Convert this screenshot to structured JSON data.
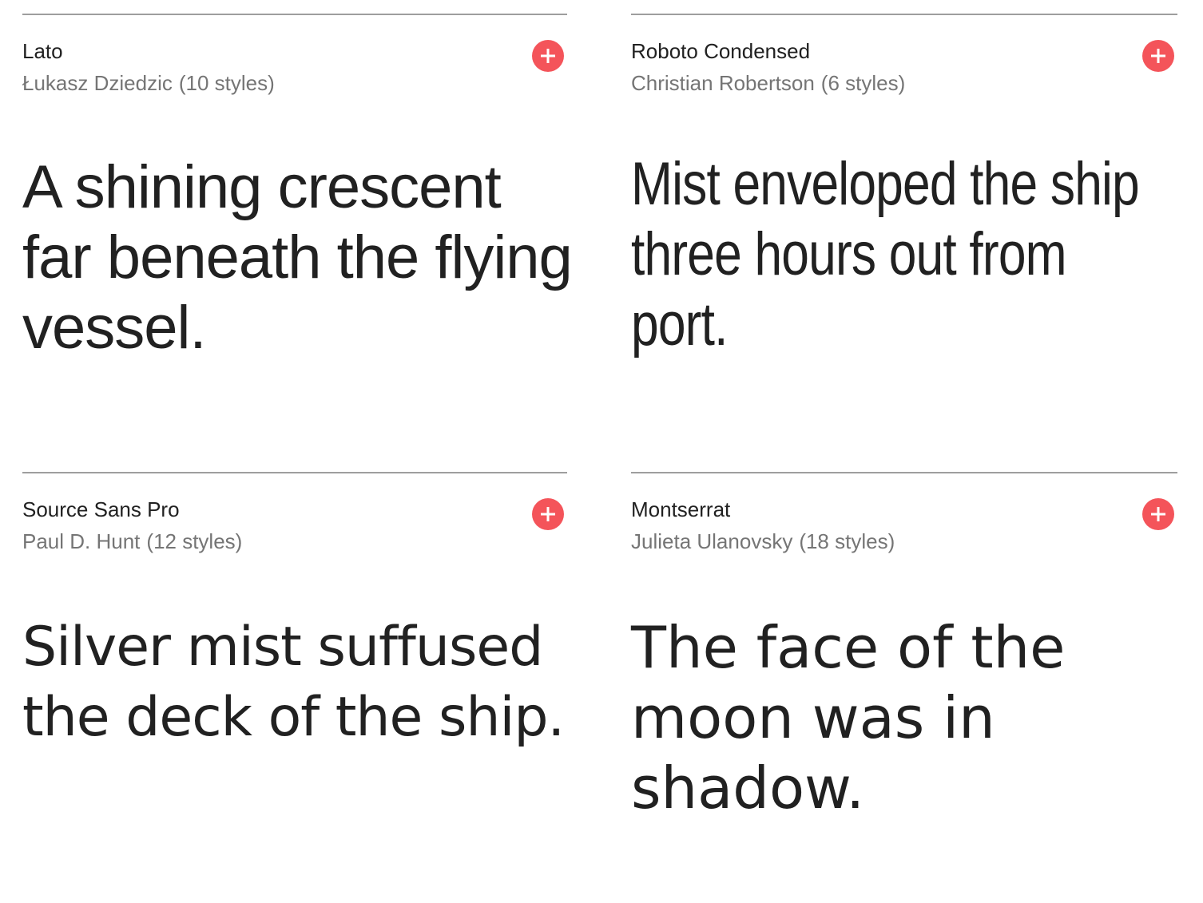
{
  "accent_color": "#f4545a",
  "fonts": [
    {
      "name": "Lato",
      "designer": "Łukasz Dziedzic",
      "styles": "(10 styles)",
      "sample": "A shining crescent far beneath the flying vessel.",
      "add_icon": "plus-icon"
    },
    {
      "name": "Roboto Condensed",
      "designer": "Christian Robertson",
      "styles": "(6 styles)",
      "sample": "Mist enveloped the ship three hours out from port.",
      "add_icon": "plus-icon"
    },
    {
      "name": "Source Sans Pro",
      "designer": "Paul D. Hunt",
      "styles": "(12 styles)",
      "sample": "Silver mist suffused the deck of the ship.",
      "add_icon": "plus-icon"
    },
    {
      "name": "Montserrat",
      "designer": "Julieta Ulanovsky",
      "styles": "(18 styles)",
      "sample": "The face of the moon was in shadow.",
      "add_icon": "plus-icon"
    }
  ]
}
